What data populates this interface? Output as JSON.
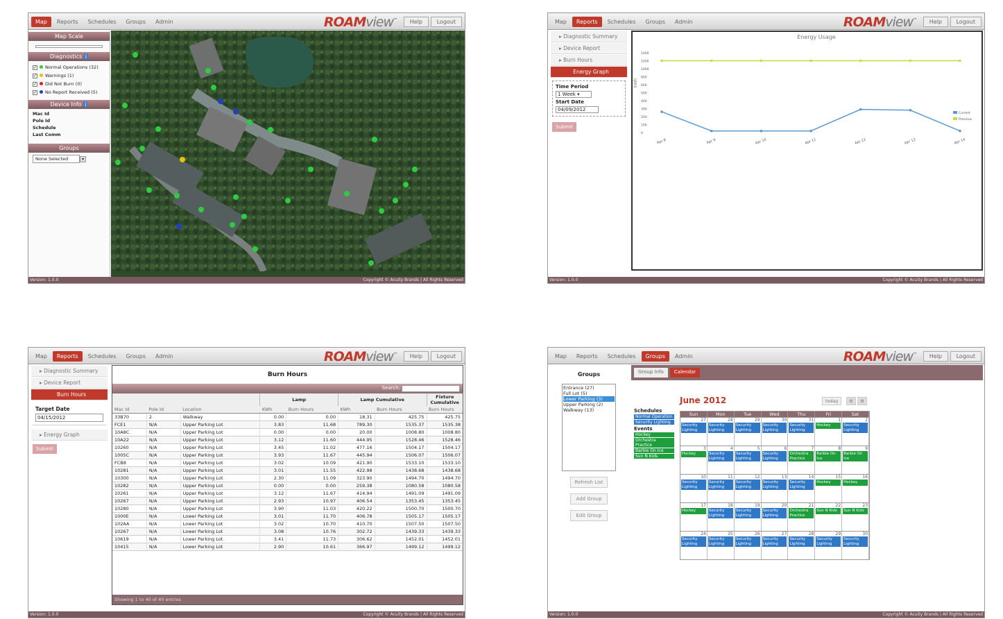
{
  "nav_tabs": [
    "Map",
    "Reports",
    "Schedules",
    "Groups",
    "Admin"
  ],
  "logo": {
    "brand": "ROAM",
    "suffix": "view",
    "tm": "™"
  },
  "help_label": "Help",
  "logout_label": "Logout",
  "footer": {
    "version": "Version: 1.0.0",
    "copyright": "Copyright © Acuity Brands | All Rights Reserved"
  },
  "map_screen": {
    "map_scale_title": "Map Scale",
    "diagnostics_title": "Diagnostics",
    "diagnostics": [
      {
        "label": "Normal Operations (32)",
        "color": "#2ecc40"
      },
      {
        "label": "Warnings (1)",
        "color": "#e6c300"
      },
      {
        "label": "Did Not Burn (0)",
        "color": "#e02020"
      },
      {
        "label": "No Report Received (5)",
        "color": "#2040c0"
      }
    ],
    "device_info_title": "Device Info",
    "device_info": [
      "Mac Id",
      "Pole Id",
      "Schedule",
      "Last Comm"
    ],
    "groups_title": "Groups",
    "groups_select": "None Selected"
  },
  "reports_side": [
    "Diagnostic Summary",
    "Device Report",
    "Burn Hours",
    "Energy Graph"
  ],
  "energy_screen": {
    "title": "Energy Usage",
    "time_period_label": "Time Period",
    "time_period_value": "1 Week",
    "start_date_label": "Start Date",
    "start_date_value": "04/09/2012",
    "submit_label": "Submit",
    "ylabel": "kWh",
    "chart_data": {
      "type": "line",
      "title": "Energy Usage",
      "ylabel": "kWh",
      "categories": [
        "Apr 8",
        "Apr 9",
        "Apr 10",
        "Apr 11",
        "Apr 12",
        "Apr 13",
        "Apr 14"
      ],
      "yticks": [
        0,
        100,
        200,
        300,
        400,
        500,
        600,
        800,
        1000,
        1200,
        1400
      ],
      "ylim": [
        0,
        1400
      ],
      "series": [
        {
          "name": "Current",
          "color": "#5b9bd5",
          "values": [
            260,
            20,
            20,
            20,
            290,
            280,
            20
          ]
        },
        {
          "name": "Previous",
          "color": "#c8d84a",
          "values": [
            1200,
            1200,
            1200,
            1200,
            1200,
            1200,
            1200
          ]
        }
      ],
      "legend": "right"
    }
  },
  "burn_screen": {
    "title": "Burn Hours",
    "target_date_label": "Target Date",
    "target_date_value": "04/15/2012",
    "search_label": "Search:",
    "submit_label": "Submit",
    "group_headers": [
      "Lamp",
      "Lamp Cumulative",
      "Fixture Cumulative"
    ],
    "columns": [
      "Mac Id",
      "Pole Id",
      "Location",
      "KWh",
      "Burn Hours",
      "KWh",
      "Burn Hours",
      "Burn Hours"
    ],
    "rows": [
      [
        "33B70",
        "2",
        "Walkway",
        "0.00",
        "0.00",
        "18.31",
        "425.75",
        "425.75"
      ],
      [
        "FCE1",
        "N/A",
        "Upper Parking Lot",
        "3.83",
        "11.68",
        "789.30",
        "1535.37",
        "1535.38"
      ],
      [
        "10A8C",
        "N/A",
        "Upper Parking Lot",
        "0.00",
        "0.00",
        "20.00",
        "1008.80",
        "1008.80"
      ],
      [
        "10A22",
        "N/A",
        "Upper Parking Lot",
        "3.12",
        "11.60",
        "444.95",
        "1528.46",
        "1528.46"
      ],
      [
        "10260",
        "N/A",
        "Upper Parking Lot",
        "3.45",
        "11.02",
        "477.16",
        "1504.17",
        "1504.17"
      ],
      [
        "1005C",
        "N/A",
        "Upper Parking Lot",
        "3.93",
        "11.67",
        "445.94",
        "1506.07",
        "1506.07"
      ],
      [
        "FCB8",
        "N/A",
        "Upper Parking Lot",
        "3.02",
        "10.09",
        "421.90",
        "1533.10",
        "1533.10"
      ],
      [
        "10281",
        "N/A",
        "Upper Parking Lot",
        "3.01",
        "11.55",
        "422.98",
        "1438.68",
        "1438.68"
      ],
      [
        "10300",
        "N/A",
        "Upper Parking Lot",
        "2.30",
        "11.09",
        "323.90",
        "1494.70",
        "1494.70"
      ],
      [
        "10282",
        "N/A",
        "Upper Parking Lot",
        "0.00",
        "0.00",
        "259.38",
        "1080.58",
        "1080.58"
      ],
      [
        "10261",
        "N/A",
        "Upper Parking Lot",
        "3.12",
        "11.67",
        "414.94",
        "1491.09",
        "1491.09"
      ],
      [
        "10267",
        "N/A",
        "Upper Parking Lot",
        "2.93",
        "10.97",
        "406.54",
        "1353.45",
        "1353.45"
      ],
      [
        "10280",
        "N/A",
        "Upper Parking Lot",
        "3.90",
        "11.03",
        "420.22",
        "1500.70",
        "1500.70"
      ],
      [
        "1000E",
        "N/A",
        "Lower Parking Lot",
        "3.01",
        "11.70",
        "406.78",
        "1505.17",
        "1505.17"
      ],
      [
        "102AA",
        "N/A",
        "Lower Parking Lot",
        "3.02",
        "10.70",
        "410.70",
        "1507.50",
        "1507.50"
      ],
      [
        "10267",
        "N/A",
        "Lower Parking Lot",
        "3.08",
        "10.76",
        "302.72",
        "1439.33",
        "1439.33"
      ],
      [
        "10619",
        "N/A",
        "Lower Parking Lot",
        "3.41",
        "11.73",
        "306.62",
        "1452.01",
        "1452.01"
      ],
      [
        "10415",
        "N/A",
        "Lower Parking Lot",
        "2.90",
        "10.61",
        "366.97",
        "1499.12",
        "1499.12"
      ]
    ],
    "showing": "Showing 1 to 40 of 40 entries"
  },
  "groups_screen": {
    "groups_title": "Groups",
    "groups_list": [
      "Entrance (27)",
      "Full Lot (5)",
      "Lower Parking (3)",
      "Upper Parking (2)",
      "Walkway (13)"
    ],
    "selected_group": 2,
    "buttons": [
      "Refresh List",
      "Add Group",
      "Edit Group"
    ],
    "tabs": [
      "Group Info",
      "Calendar"
    ],
    "month_title": "June 2012",
    "today_label": "today",
    "schedules_title": "Schedules",
    "schedules": [
      "Normal Operation",
      "Security Lighting"
    ],
    "events_title": "Events",
    "events": [
      "Hockey",
      "Orchestra Practice",
      "Barbie On Ice",
      "Sun N Kids"
    ],
    "weekdays": [
      "Sun",
      "Mon",
      "Tue",
      "Wed",
      "Thu",
      "Fri",
      "Sat"
    ],
    "weeks": [
      [
        {
          "d": "27",
          "e": [
            [
              "Security Lighting",
              "b"
            ]
          ]
        },
        {
          "d": "28",
          "e": [
            [
              "Security Lighting",
              "b"
            ]
          ]
        },
        {
          "d": "29",
          "e": [
            [
              "Security Lighting",
              "b"
            ]
          ]
        },
        {
          "d": "30",
          "e": [
            [
              "Security Lighting",
              "b"
            ]
          ]
        },
        {
          "d": "31",
          "e": [
            [
              "Security Lighting",
              "b"
            ]
          ]
        },
        {
          "d": "1",
          "e": [
            [
              "Hockey",
              "g"
            ]
          ]
        },
        {
          "d": "2",
          "e": [
            [
              "Security Lighting",
              "b"
            ]
          ]
        }
      ],
      [
        {
          "d": "3",
          "e": [
            [
              "Hockey",
              "g"
            ]
          ]
        },
        {
          "d": "4",
          "e": [
            [
              "Security Lighting",
              "b"
            ]
          ]
        },
        {
          "d": "5",
          "e": [
            [
              "Security Lighting",
              "b"
            ]
          ]
        },
        {
          "d": "6",
          "e": [
            [
              "Security Lighting",
              "b"
            ]
          ]
        },
        {
          "d": "7",
          "e": [
            [
              "Orchestra Practice",
              "g"
            ]
          ]
        },
        {
          "d": "8",
          "e": [
            [
              "Barbie On Ice",
              "g"
            ]
          ]
        },
        {
          "d": "9",
          "e": [
            [
              "Barbie On Ice",
              "g"
            ]
          ]
        }
      ],
      [
        {
          "d": "10",
          "e": [
            [
              "Security Lighting",
              "b"
            ]
          ]
        },
        {
          "d": "11",
          "e": [
            [
              "Security Lighting",
              "b"
            ]
          ]
        },
        {
          "d": "12",
          "e": [
            [
              "Security Lighting",
              "b"
            ]
          ]
        },
        {
          "d": "13",
          "e": [
            [
              "Security Lighting",
              "b"
            ]
          ]
        },
        {
          "d": "14",
          "e": [
            [
              "Security Lighting",
              "b"
            ]
          ]
        },
        {
          "d": "15",
          "e": [
            [
              "Hockey",
              "g"
            ]
          ]
        },
        {
          "d": "16",
          "e": [
            [
              "Hockey",
              "g"
            ]
          ]
        }
      ],
      [
        {
          "d": "17",
          "e": [
            [
              "Hockey",
              "g"
            ]
          ]
        },
        {
          "d": "18",
          "e": [
            [
              "Security Lighting",
              "b"
            ]
          ]
        },
        {
          "d": "19",
          "e": [
            [
              "Security Lighting",
              "b"
            ]
          ]
        },
        {
          "d": "20",
          "e": [
            [
              "Security Lighting",
              "b"
            ]
          ]
        },
        {
          "d": "21",
          "e": [
            [
              "Orchestra Practice",
              "g"
            ]
          ]
        },
        {
          "d": "22",
          "e": [
            [
              "Sun N Kids",
              "g"
            ]
          ]
        },
        {
          "d": "23",
          "e": [
            [
              "Sun N Kids",
              "g"
            ]
          ]
        }
      ],
      [
        {
          "d": "24",
          "e": [
            [
              "Security Lighting",
              "b"
            ]
          ]
        },
        {
          "d": "25",
          "e": [
            [
              "Security Lighting",
              "b"
            ]
          ]
        },
        {
          "d": "26",
          "e": [
            [
              "Security Lighting",
              "b"
            ]
          ]
        },
        {
          "d": "27",
          "e": [
            [
              "Security Lighting",
              "b"
            ]
          ]
        },
        {
          "d": "28",
          "e": [
            [
              "Security Lighting",
              "b"
            ]
          ]
        },
        {
          "d": "29",
          "e": [
            [
              "Security Lighting",
              "b"
            ]
          ]
        },
        {
          "d": "30",
          "e": [
            [
              "Security Lighting",
              "b"
            ]
          ]
        }
      ]
    ]
  }
}
